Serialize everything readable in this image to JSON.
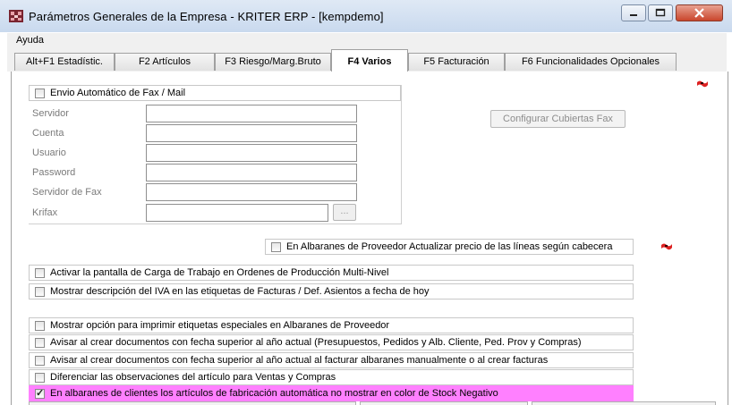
{
  "window": {
    "title": "Parámetros Generales de la Empresa - KRITER ERP - [kempdemo]",
    "close_color": "#c9462c"
  },
  "menu": {
    "items": [
      "Ayuda"
    ]
  },
  "tabs": [
    {
      "label": "Alt+F1 Estadístic.",
      "active": false
    },
    {
      "label": "F2 Artículos",
      "active": false
    },
    {
      "label": "F3 Riesgo/Marg.Bruto",
      "active": false
    },
    {
      "label": "F4 Varios",
      "active": true
    },
    {
      "label": "F5 Facturación",
      "active": false
    },
    {
      "label": "F6 Funcionalidades Opcionales",
      "active": false
    }
  ],
  "fax": {
    "enable_label": "Envio Automático de Fax / Mail",
    "enabled": false,
    "fields": [
      {
        "label": "Servidor",
        "value": ""
      },
      {
        "label": "Cuenta",
        "value": ""
      },
      {
        "label": "Usuario",
        "value": ""
      },
      {
        "label": "Password",
        "value": ""
      },
      {
        "label": "Servidor de Fax",
        "value": ""
      },
      {
        "label": "Krifax",
        "value": ""
      }
    ],
    "browse_label": "...",
    "configure_button": "Configurar Cubiertas Fax"
  },
  "options": {
    "albaranes_proveedor": {
      "label": "En Albaranes de Proveedor Actualizar precio de las líneas según cabecera",
      "checked": false
    },
    "carga_trabajo": {
      "label": "Activar la pantalla de Carga de Trabajo en Ordenes de Producción Multi-Nivel",
      "checked": false
    },
    "descripcion_iva": {
      "label": "Mostrar descripción del IVA en las etiquetas de Facturas / Def. Asientos a fecha de hoy",
      "checked": false
    },
    "etiquetas_especiales": {
      "label": "Mostrar opción para imprimir etiquetas especiales en Albaranes de Proveedor",
      "checked": false
    },
    "avisar_fecha": {
      "label": "Avisar al crear documentos con fecha superior al año actual (Presupuestos, Pedidos y  Alb. Cliente, Ped. Prov y Compras)",
      "checked": false
    },
    "avisar_facturar": {
      "label": "Avisar al crear documentos con fecha superior al año actual al facturar albaranes manualmente o al crear facturas",
      "checked": false
    },
    "diferenciar_obs": {
      "label": "Diferenciar las observaciones del artículo para Ventas y Compras",
      "checked": false
    },
    "stock_negativo": {
      "label": "En albaranes de clientes los artículos de fabricación automática no mostrar en color de Stock Negativo",
      "checked": true,
      "highlight_color": "#ff80ff"
    }
  }
}
